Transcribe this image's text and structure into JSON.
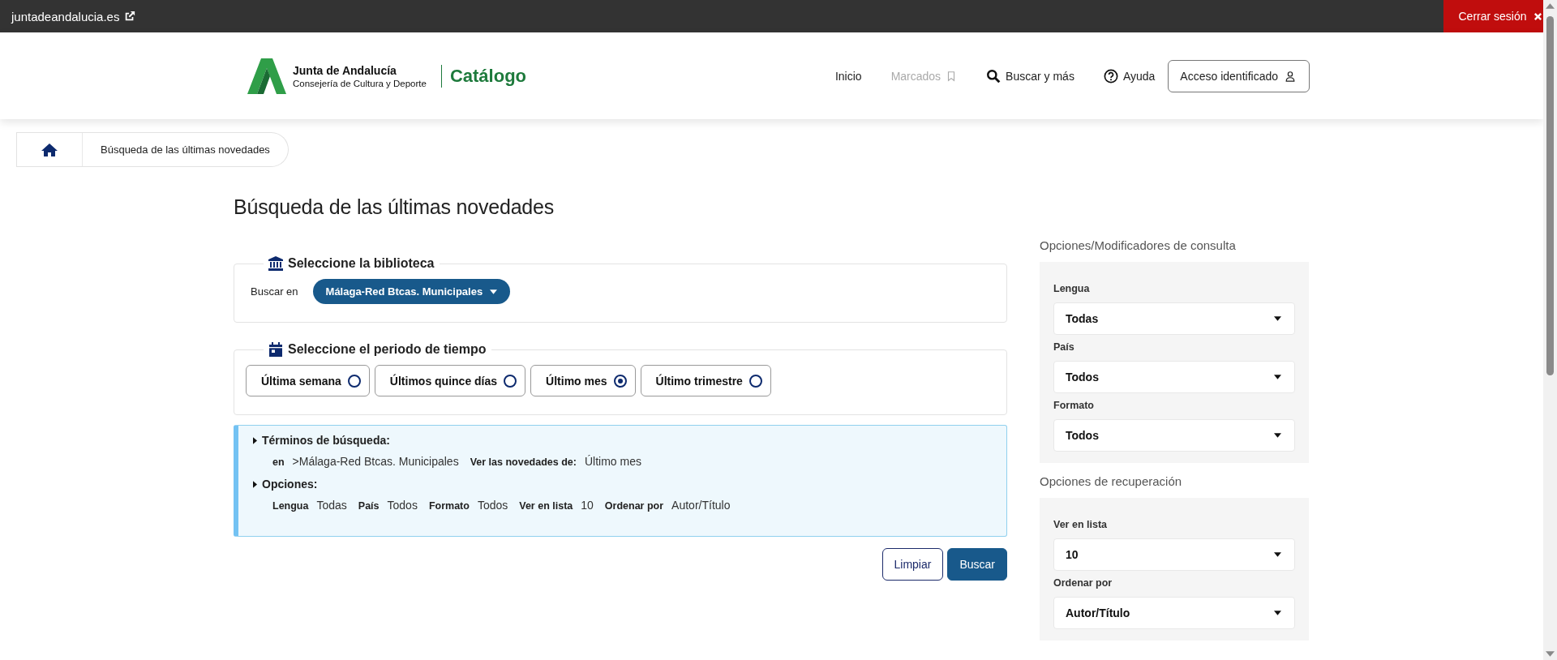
{
  "top_bar": {
    "site_link": "juntadeandalucia.es",
    "logout": "Cerrar sesión"
  },
  "header": {
    "logo_title": "Junta de Andalucía",
    "logo_subtitle": "Consejería de Cultura y Deporte",
    "catalog": "Catálogo",
    "nav": [
      {
        "label": "Inicio",
        "kind": "plain",
        "disabled": false
      },
      {
        "label": "Marcados",
        "kind": "bookmark",
        "disabled": true
      },
      {
        "label": "Buscar y más",
        "kind": "search",
        "disabled": false
      },
      {
        "label": "Ayuda",
        "kind": "help",
        "disabled": false
      },
      {
        "label": "Acceso identificado",
        "kind": "account",
        "disabled": false
      }
    ]
  },
  "breadcrumb": {
    "current": "Búsqueda de las últimas novedades"
  },
  "title": "Búsqueda de las últimas novedades",
  "library": {
    "legend": "Seleccione la biblioteca",
    "label": "Buscar en",
    "value": "Málaga-Red Btcas. Municipales"
  },
  "period": {
    "legend": "Seleccione el periodo de tiempo",
    "options": [
      {
        "label": "Última semana",
        "selected": false
      },
      {
        "label": "Últimos quince días",
        "selected": false
      },
      {
        "label": "Último mes",
        "selected": true
      },
      {
        "label": "Último trimestre",
        "selected": false
      }
    ]
  },
  "summary": {
    "terms_heading": "Términos de búsqueda:",
    "terms": [
      {
        "label": "en",
        "value": ">Málaga-Red Btcas. Municipales"
      },
      {
        "label": "Ver las novedades de:",
        "value": "Último mes"
      }
    ],
    "options_heading": "Opciones:",
    "options": [
      {
        "label": "Lengua",
        "value": "Todas"
      },
      {
        "label": "País",
        "value": "Todos"
      },
      {
        "label": "Formato",
        "value": "Todos"
      },
      {
        "label": "Ver en lista",
        "value": "10"
      },
      {
        "label": "Ordenar por",
        "value": "Autor/Título"
      }
    ]
  },
  "buttons": [
    {
      "label": "Limpiar",
      "kind": "outline"
    },
    {
      "label": "Buscar",
      "kind": "primary"
    }
  ],
  "sidebar": [
    {
      "heading": "Opciones/Modificadores de consulta",
      "fields": [
        {
          "label": "Lengua",
          "value": "Todas"
        },
        {
          "label": "País",
          "value": "Todos"
        },
        {
          "label": "Formato",
          "value": "Todos"
        }
      ]
    },
    {
      "heading": "Opciones de recuperación",
      "fields": [
        {
          "label": "Ver en lista",
          "value": "10"
        },
        {
          "label": "Ordenar por",
          "value": "Autor/Título"
        }
      ]
    }
  ]
}
